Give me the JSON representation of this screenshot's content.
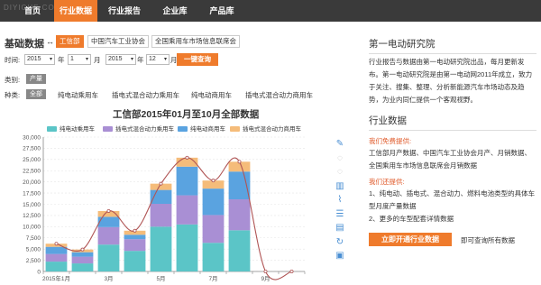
{
  "watermark": "DIYICHE.COM",
  "nav": {
    "items": [
      "首页",
      "行业数据",
      "行业报告",
      "企业库",
      "产品库"
    ],
    "active_index": 1,
    "active_color": "#ef7b2c",
    "bg_color": "#3a3a3a"
  },
  "filters": {
    "title": "基础数据",
    "arrow": "↔",
    "sources": [
      "工信部",
      "中国汽车工业协会",
      "全国乘用车市场信息联席会"
    ],
    "active_source": 0,
    "time_label": "时间:",
    "from_year": "2015",
    "year_unit": "年",
    "from_month": "1",
    "month_unit": "月",
    "dash": "→",
    "to_year": "2015",
    "to_month": "12",
    "query_button": "一键查询",
    "category_label": "类别:",
    "category_value": "产量",
    "kind_label": "种类:",
    "kinds": [
      "全部",
      "纯电动乘用车",
      "插电式混合动力乘用车",
      "纯电动商用车",
      "插电式混合动力商用车"
    ],
    "active_kind": 0
  },
  "tool_icons": [
    "pencil-icon",
    "circle-icon",
    "circle-icon",
    "bar-chart-icon",
    "line-chart-icon",
    "stack-icon",
    "tiled-icon",
    "refresh-icon",
    "save-icon"
  ],
  "sidebar": {
    "title": "第一电动研究院",
    "intro": "行业报告与数据由第一电动研究院出品，每月更新发布。第一电动研究院是由第一电动网2011年成立，致力于关注、搜集、整理、分析新能源汽车市场动态及趋势，为业内同仁提供一个客观视野。",
    "data_title": "行业数据",
    "free_label": "我们免费提供:",
    "free_text": "工信部月产数据、中国汽车工业协会月产、月销数据、全国乘用车市场信息联席会月销数据",
    "also_label": "我们还提供:",
    "also_text_1": "1、纯电动、插电式、混合动力、燃料电池类型的具体车型月度产量数据",
    "also_text_2": "2、更多的车型配套详情数据",
    "open_button": "立即开通行业数据",
    "open_note": "即可查询所有数据"
  },
  "chart_data": {
    "type": "bar",
    "stacked": true,
    "title": "工信部2015年01月至10月全部数据",
    "categories": [
      "2015年1月",
      "2月",
      "3月",
      "4月",
      "5月",
      "6月",
      "7月",
      "8月",
      "9月",
      "10月"
    ],
    "tick_labels": [
      "2015年1月",
      "",
      "3月",
      "",
      "5月",
      "",
      "7月",
      "",
      "9月",
      ""
    ],
    "ylim": [
      0,
      30000
    ],
    "yticks": [
      0,
      2500,
      5000,
      7500,
      10000,
      12500,
      15000,
      17500,
      20000,
      22500,
      25000,
      27500,
      30000
    ],
    "ytick_labels": [
      "0",
      "2,500",
      "5,000",
      "7,500",
      "10,000",
      "12,500",
      "15,000",
      "17,500",
      "20,000",
      "22,500",
      "25,000",
      "27,500",
      "30,000"
    ],
    "grid": true,
    "legend_position": "top",
    "series": [
      {
        "name": "纯电动乘用车",
        "color": "#5bc5c7",
        "values": [
          2200,
          1800,
          6000,
          4600,
          10000,
          10500,
          6400,
          9200,
          0,
          0
        ]
      },
      {
        "name": "插电式混合动力乘用车",
        "color": "#a98fd4",
        "values": [
          1700,
          1500,
          3900,
          2600,
          5100,
          6500,
          6200,
          6900,
          0,
          0
        ]
      },
      {
        "name": "纯电动商用车",
        "color": "#5aa3e0",
        "values": [
          1600,
          1000,
          2300,
          1000,
          3100,
          6400,
          5900,
          6200,
          0,
          0
        ]
      },
      {
        "name": "插电式混合动力商用车",
        "color": "#f5bc7a",
        "values": [
          700,
          600,
          1300,
          900,
          1400,
          2000,
          1800,
          2200,
          0,
          0
        ]
      }
    ],
    "line": {
      "color": "#b05555",
      "values": [
        6200,
        4900,
        13500,
        9100,
        19600,
        25400,
        20300,
        24500,
        0,
        0
      ]
    }
  }
}
